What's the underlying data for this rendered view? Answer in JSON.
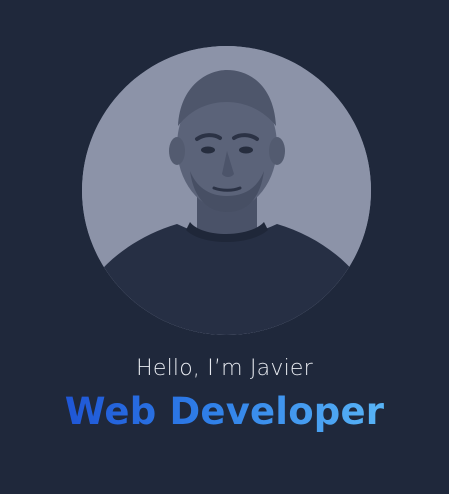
{
  "profile": {
    "greeting": "Hello, I’m Javier",
    "role": "Web Developer",
    "photo_alt": ""
  },
  "colors": {
    "background": "#1f283b",
    "greeting_text": "#e6e9ef",
    "role_gradient_start": "#1f56d6",
    "role_gradient_end": "#58b4f6",
    "avatar_bg": "#8c93a8"
  }
}
